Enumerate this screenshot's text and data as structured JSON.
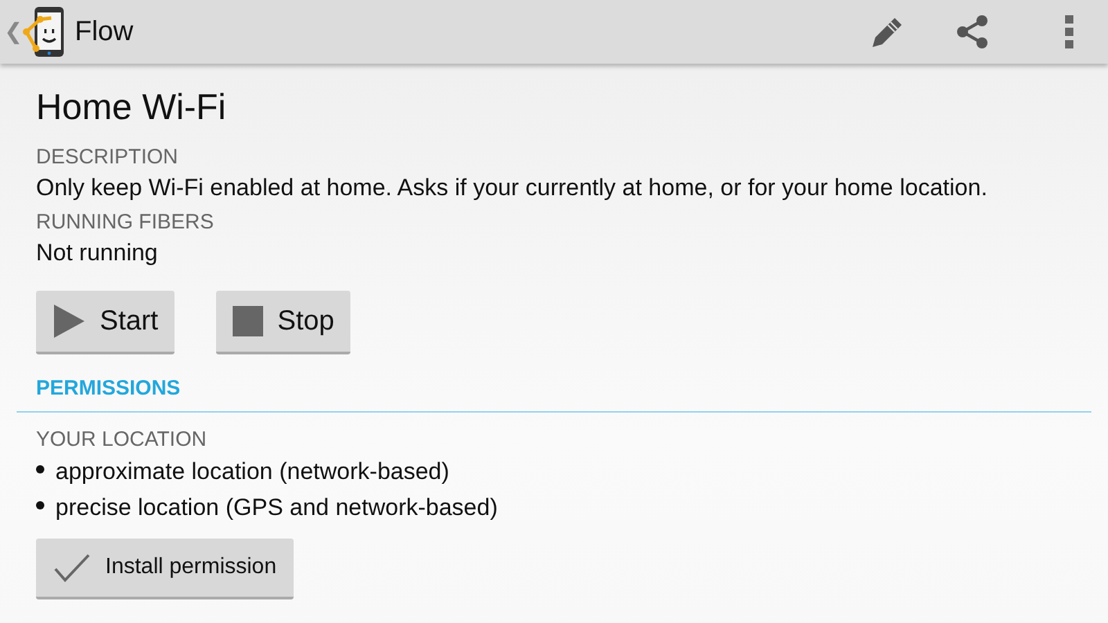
{
  "app_bar": {
    "back": "❮",
    "title": "Flow"
  },
  "title": "Home Wi-Fi",
  "description": {
    "label": "DESCRIPTION",
    "text": "Only keep Wi-Fi enabled at home. Asks if your currently at home, or for your home location."
  },
  "running_fibers": {
    "label": "RUNNING FIBERS",
    "text": "Not running"
  },
  "buttons": [
    {
      "kind": "start",
      "label": "Start"
    },
    {
      "kind": "stop",
      "label": "Stop"
    }
  ],
  "permissions": {
    "heading": "PERMISSIONS",
    "group": "YOUR LOCATION",
    "items": [
      "approximate location (network-based)",
      "precise location (GPS and network-based)"
    ],
    "button": "Install permission"
  }
}
